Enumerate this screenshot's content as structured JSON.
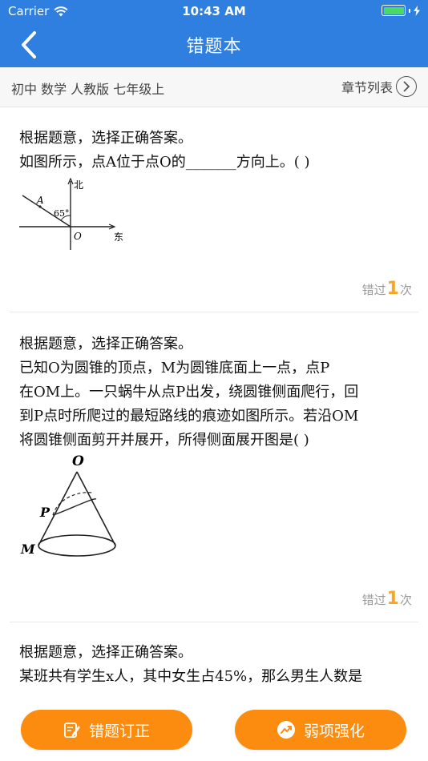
{
  "status_bar": {
    "carrier": "Carrier",
    "time": "10:43 AM"
  },
  "nav": {
    "title": "错题本"
  },
  "subheader": {
    "book_info": "初中 数学 人教版 七年级上",
    "chapter_list": "章节列表"
  },
  "questions": [
    {
      "instruction": "根据题意，选择正确答案。",
      "lines": [
        "如图所示，点A位于点O的_______方向上。(          )"
      ],
      "figure_labels": {
        "north": "北",
        "east": "东",
        "point_a": "A",
        "point_o": "O",
        "angle": "65°"
      },
      "wrong_prefix": "错过",
      "wrong_count": "1",
      "wrong_suffix": "次"
    },
    {
      "instruction": "根据题意，选择正确答案。",
      "lines": [
        "已知O为圆锥的顶点，M为圆锥底面上一点，点P",
        "在OM上。一只蜗牛从点P出发，绕圆锥侧面爬行，回",
        "到P点时所爬过的最短路线的痕迹如图所示。若沿OM",
        "将圆锥侧面剪开并展开，所得侧面展开图是(          )"
      ],
      "figure_labels": {
        "point_o": "O",
        "point_p": "P",
        "point_m": "M"
      },
      "wrong_prefix": "错过",
      "wrong_count": "1",
      "wrong_suffix": "次"
    },
    {
      "instruction": "根据题意，选择正确答案。",
      "lines": [
        "某班共有学生x人，其中女生占45%，那么男生人数是",
        "(     )"
      ]
    }
  ],
  "footer": {
    "correct_label": "错题订正",
    "strengthen_label": "弱项强化"
  },
  "colors": {
    "header": "#2f7fe0",
    "button": "#fb8c0f",
    "count": "#f6a623",
    "battery": "#4cd964"
  }
}
